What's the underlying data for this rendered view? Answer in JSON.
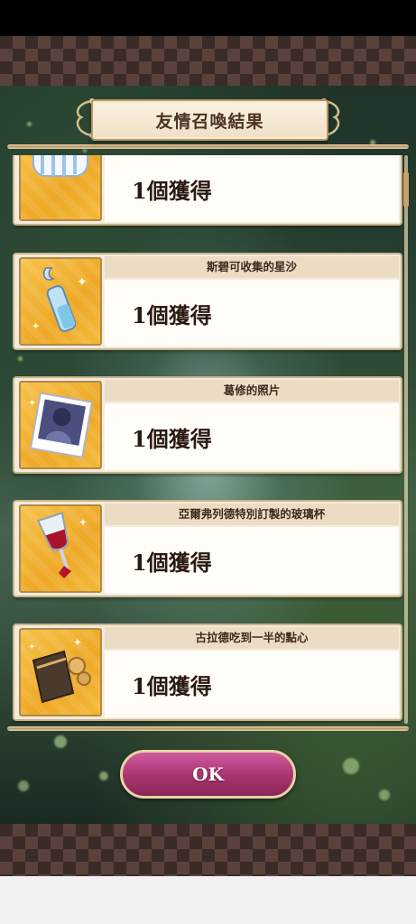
{
  "title": "友情召喚結果",
  "items": [
    {
      "name": "",
      "quantity": "1個獲得",
      "icon": "pillow-icon"
    },
    {
      "name": "斯碧可收集的星沙",
      "quantity": "1個獲得",
      "icon": "star-sand-bottle-icon"
    },
    {
      "name": "葛修的照片",
      "quantity": "1個獲得",
      "icon": "photo-icon"
    },
    {
      "name": "亞爾弗列德特別訂製的玻璃杯",
      "quantity": "1個獲得",
      "icon": "wine-glass-icon"
    },
    {
      "name": "古拉德吃到一半的點心",
      "quantity": "1個獲得",
      "icon": "snack-bag-icon"
    }
  ],
  "ok_button": "OK",
  "colors": {
    "accent": "#a8346f",
    "frame": "#c9b38a",
    "icon_bg": "#f0ad2b"
  }
}
